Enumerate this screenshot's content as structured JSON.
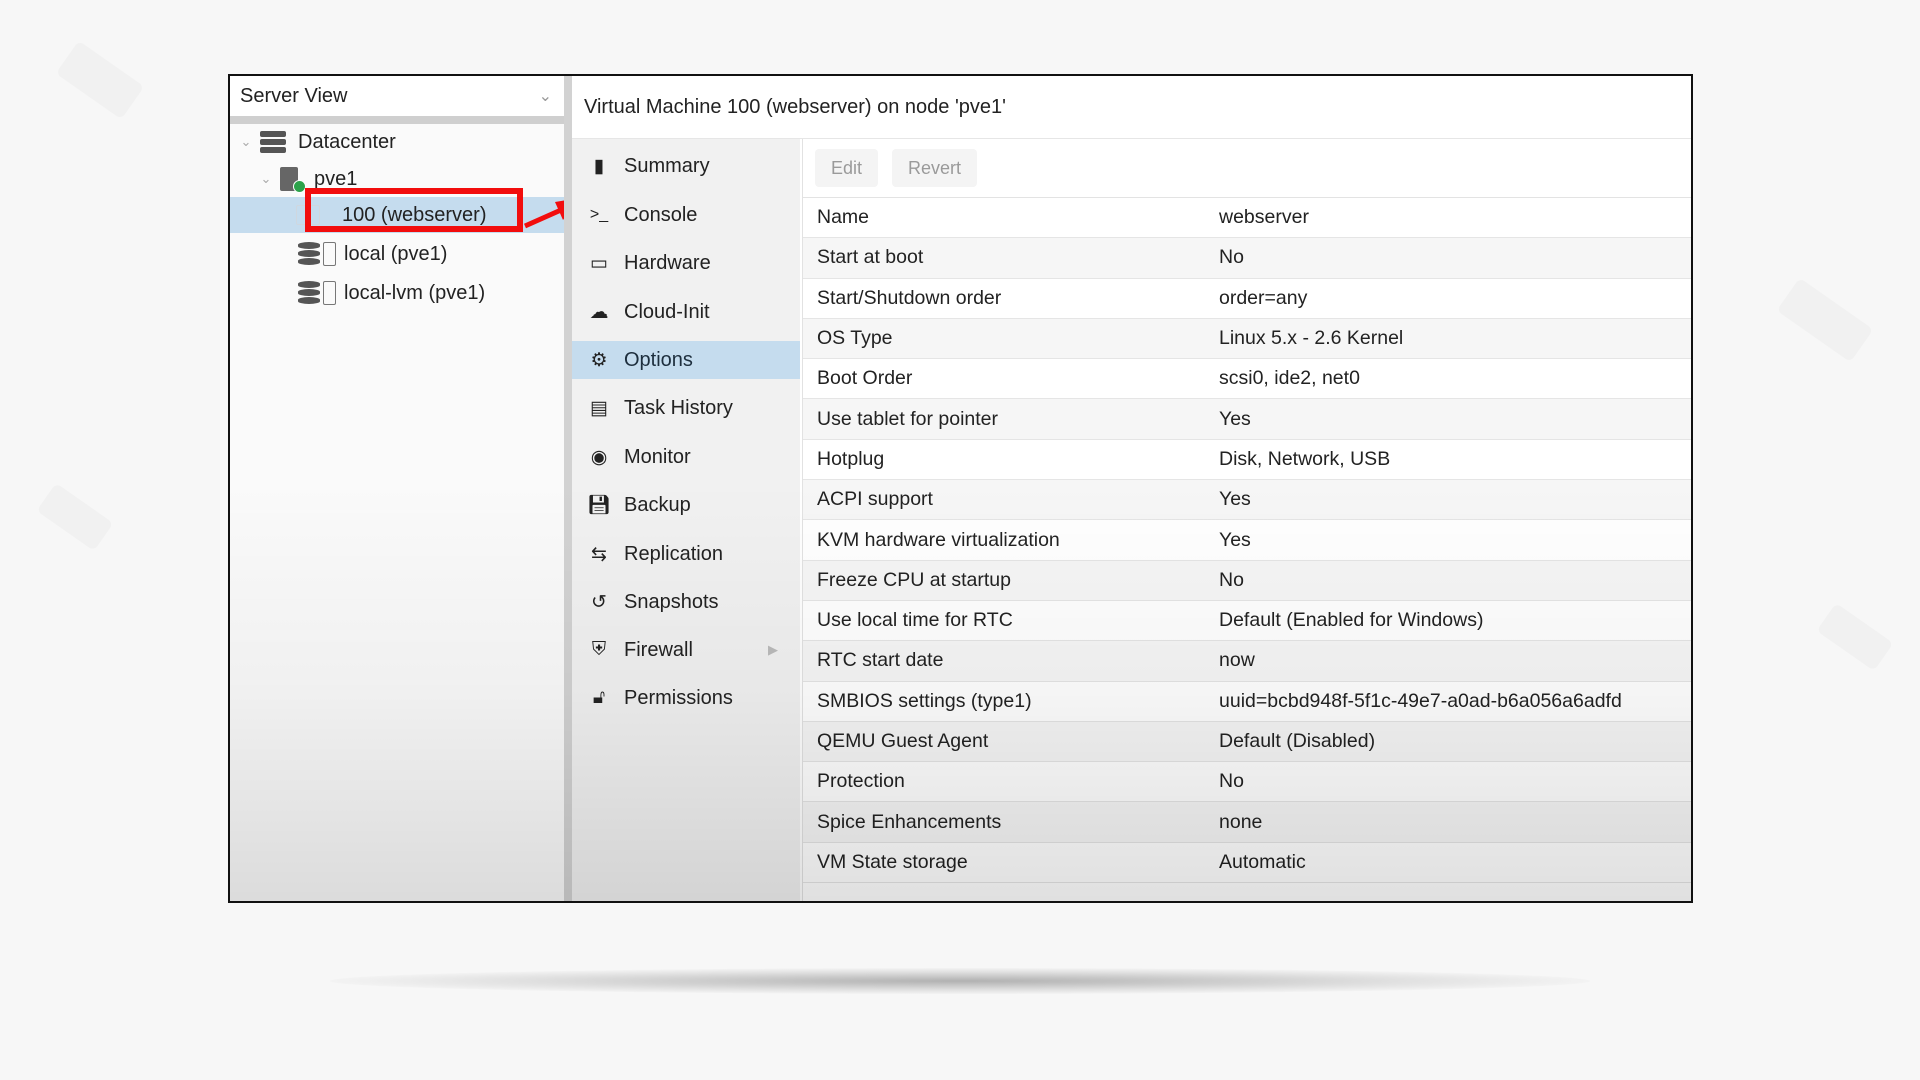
{
  "tree": {
    "view_label": "Server View",
    "nodes": [
      {
        "label": "Datacenter",
        "icon": "datacenter-icon"
      },
      {
        "label": "pve1",
        "icon": "server-online-icon"
      },
      {
        "label": "100 (webserver)",
        "icon": "vm-icon",
        "selected": true
      },
      {
        "label": "local (pve1)",
        "icon": "storage-icon"
      },
      {
        "label": "local-lvm (pve1)",
        "icon": "storage-icon"
      }
    ]
  },
  "annotation": {
    "highlight_color": "#f20d0d",
    "target": "100 (webserver)"
  },
  "header": {
    "title": "Virtual Machine 100 (webserver) on node 'pve1'"
  },
  "nav": {
    "items": [
      {
        "label": "Summary",
        "icon": "book-icon"
      },
      {
        "label": "Console",
        "icon": "terminal-icon"
      },
      {
        "label": "Hardware",
        "icon": "monitor-icon"
      },
      {
        "label": "Cloud-Init",
        "icon": "cloud-icon"
      },
      {
        "label": "Options",
        "icon": "gear-icon",
        "selected": true
      },
      {
        "label": "Task History",
        "icon": "list-icon"
      },
      {
        "label": "Monitor",
        "icon": "eye-icon"
      },
      {
        "label": "Backup",
        "icon": "floppy-icon"
      },
      {
        "label": "Replication",
        "icon": "retweet-icon"
      },
      {
        "label": "Snapshots",
        "icon": "history-icon"
      },
      {
        "label": "Firewall",
        "icon": "shield-icon",
        "has_submenu": true
      },
      {
        "label": "Permissions",
        "icon": "unlock-icon"
      }
    ]
  },
  "toolbar": {
    "edit_label": "Edit",
    "revert_label": "Revert"
  },
  "options": [
    {
      "key": "Name",
      "value": "webserver"
    },
    {
      "key": "Start at boot",
      "value": "No"
    },
    {
      "key": "Start/Shutdown order",
      "value": "order=any"
    },
    {
      "key": "OS Type",
      "value": "Linux 5.x - 2.6 Kernel"
    },
    {
      "key": "Boot Order",
      "value": "scsi0, ide2, net0"
    },
    {
      "key": "Use tablet for pointer",
      "value": "Yes"
    },
    {
      "key": "Hotplug",
      "value": "Disk, Network, USB"
    },
    {
      "key": "ACPI support",
      "value": "Yes"
    },
    {
      "key": "KVM hardware virtualization",
      "value": "Yes"
    },
    {
      "key": "Freeze CPU at startup",
      "value": "No"
    },
    {
      "key": "Use local time for RTC",
      "value": "Default (Enabled for Windows)"
    },
    {
      "key": "RTC start date",
      "value": "now"
    },
    {
      "key": "SMBIOS settings (type1)",
      "value": "uuid=bcbd948f-5f1c-49e7-a0ad-b6a056a6adfd"
    },
    {
      "key": "QEMU Guest Agent",
      "value": "Default (Disabled)"
    },
    {
      "key": "Protection",
      "value": "No"
    },
    {
      "key": "Spice Enhancements",
      "value": "none"
    },
    {
      "key": "VM State storage",
      "value": "Automatic"
    }
  ]
}
